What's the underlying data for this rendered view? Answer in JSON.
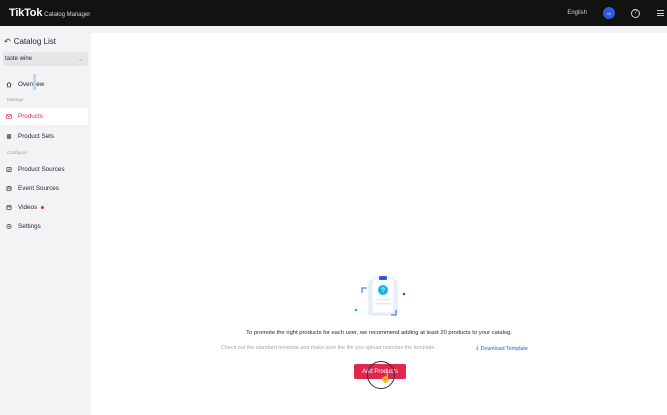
{
  "topbar": {
    "logo": "TikTok",
    "product": "Catalog Manager",
    "language": "English",
    "avatar_initials": "m",
    "help_glyph": "?"
  },
  "sidebar": {
    "back_label": "Catalog List",
    "catalog_name": "taste wine",
    "overview": "Overview",
    "section_manage": "Manage",
    "products": "Products",
    "product_sets": "Product Sets",
    "section_configure": "Configure",
    "product_sources": "Product Sources",
    "event_sources": "Event Sources",
    "videos": "Videos",
    "settings": "Settings"
  },
  "empty_state": {
    "message": "To promote the right products for each user, we recommend adding at least 20 products to your catalog.",
    "hint": "Check out the standard template and make sure the file you upload matches the template.",
    "download_label": "Download Template",
    "add_button": "Add Products"
  },
  "colors": {
    "accent": "#e2264d",
    "link": "#2f5bd8",
    "topbar": "#121212"
  },
  "icons": {
    "back": "undo-icon",
    "overview": "home-icon",
    "products": "mail-icon",
    "product_sets": "stack-icon",
    "product_sources": "edit-doc-icon",
    "event_sources": "calendar-icon",
    "videos": "video-icon",
    "settings": "gear-icon",
    "download": "download-icon"
  }
}
